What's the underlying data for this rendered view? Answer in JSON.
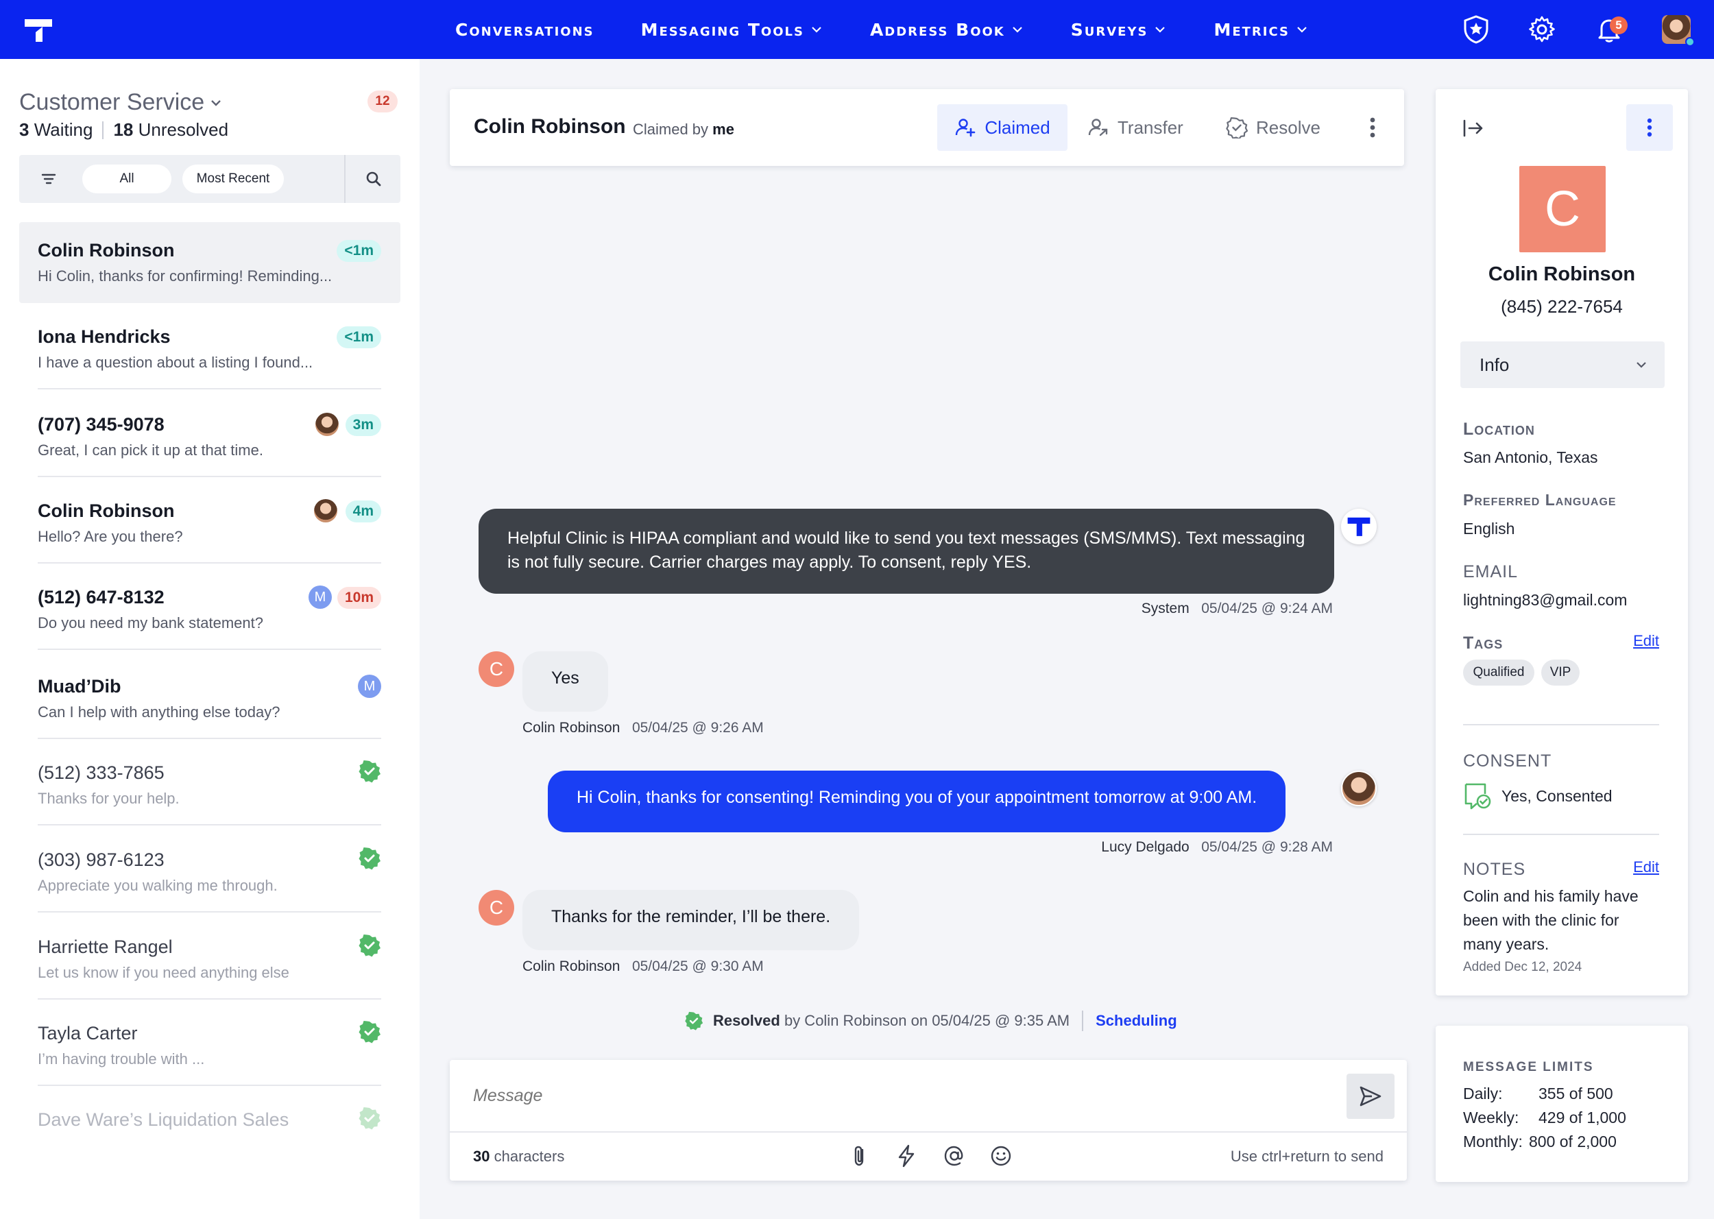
{
  "nav": {
    "items": [
      {
        "label": "Conversations",
        "has_menu": false
      },
      {
        "label": "Messaging Tools",
        "has_menu": true
      },
      {
        "label": "Address Book",
        "has_menu": true
      },
      {
        "label": "Surveys",
        "has_menu": true
      },
      {
        "label": "Metrics",
        "has_menu": true
      }
    ],
    "icons": [
      "shield-star-icon",
      "gear-icon",
      "bell-icon",
      "user-avatar"
    ],
    "notification_count": "5",
    "colors": {
      "bar": "#0a24ef",
      "accent": "#1d3df2"
    }
  },
  "inbox": {
    "title": "Customer Service",
    "badge": "12",
    "waiting_count": "3",
    "waiting_label": "Waiting",
    "unresolved_count": "18",
    "unresolved_label": "Unresolved",
    "filters": [
      "All",
      "Most Recent"
    ]
  },
  "conversations": [
    {
      "name": "Colin Robinson",
      "preview": "Hi Colin, thanks for confirming! Reminding...",
      "time": "<1m",
      "state": "active"
    },
    {
      "name": "Iona Hendricks",
      "preview": "I have a question about a listing I found...",
      "time": "<1m",
      "state": "unread"
    },
    {
      "name": "(707) 345-9078",
      "preview": "Great, I can pick it up at that time.",
      "time": "3m",
      "state": "unread",
      "assignee": "avatar"
    },
    {
      "name": "Colin Robinson",
      "preview": "Hello? Are you there?",
      "time": "4m",
      "state": "unread",
      "assignee": "avatar"
    },
    {
      "name": "(512) 647-8132",
      "preview": "Do you need my bank statement?",
      "time": "10m",
      "state": "unread",
      "assignee": "M"
    },
    {
      "name": "Muad’Dib",
      "preview": "Can I help with anything else today?",
      "time": "",
      "state": "unread",
      "assignee": "M"
    },
    {
      "name": "(512) 333-7865",
      "preview": "Thanks for your help.",
      "state": "resolved"
    },
    {
      "name": "(303) 987-6123",
      "preview": "Appreciate you walking me through.",
      "state": "resolved"
    },
    {
      "name": "Harriette Rangel",
      "preview": "Let us know if you need anything else",
      "state": "resolved"
    },
    {
      "name": "Tayla Carter",
      "preview": "I’m having trouble with ...",
      "state": "resolved"
    },
    {
      "name": "Dave Ware’s Liquidation Sales",
      "preview": "",
      "state": "resolved-faded"
    }
  ],
  "conversation_header": {
    "name": "Colin Robinson",
    "claimed_by_prefix": "Claimed by",
    "claimed_by": "me",
    "actions": {
      "claimed": "Claimed",
      "transfer": "Transfer",
      "resolve": "Resolve"
    }
  },
  "messages": [
    {
      "type": "system",
      "text": "Helpful Clinic is HIPAA compliant and would like to send you text messages (SMS/MMS). Text messaging is not fully secure. Carrier charges may apply. To consent, reply YES.",
      "sender": "System",
      "timestamp": "05/04/25 @ 9:24 AM"
    },
    {
      "type": "inbound",
      "text": "Yes",
      "sender": "Colin Robinson",
      "timestamp": "05/04/25 @ 9:26 AM",
      "avatar_letter": "C"
    },
    {
      "type": "outbound",
      "text": "Hi Colin, thanks for consenting! Reminding you of your appointment tomorrow at 9:00 AM.",
      "sender": "Lucy Delgado",
      "timestamp": "05/04/25 @ 9:28 AM"
    },
    {
      "type": "inbound",
      "text": "Thanks for the reminder, I’ll be there.",
      "sender": "Colin Robinson",
      "timestamp": "05/04/25 @ 9:30 AM",
      "avatar_letter": "C"
    }
  ],
  "resolution": {
    "label": "Resolved",
    "detail": "by Colin Robinson on 05/04/25 @ 9:35 AM",
    "tag_link": "Scheduling"
  },
  "composer": {
    "placeholder": "Message",
    "char_count": "30",
    "char_label": "characters",
    "hint": "Use ctrl+return to send",
    "tools": [
      "paperclip-icon",
      "lightning-icon",
      "at-sign-icon",
      "emoji-icon"
    ]
  },
  "contact": {
    "initial": "C",
    "name": "Colin Robinson",
    "phone": "(845) 222-7654",
    "section_select": "Info",
    "location_label": "Location",
    "location": "San Antonio, Texas",
    "language_label": "Preferred Language",
    "language": "English",
    "email_label": "EMAIL",
    "email": "lightning83@gmail.com",
    "tags_label": "Tags",
    "tags_edit": "Edit",
    "tags": [
      "Qualified",
      "VIP"
    ],
    "consent_label": "CONSENT",
    "consent_value": "Yes, Consented",
    "notes_label": "NOTES",
    "notes_edit": "Edit",
    "notes_line1": "Colin and his family have",
    "notes_line2": "been with the clinic for",
    "notes_line3": "many years.",
    "notes_added": "Added Dec 12, 2024",
    "avatar_color": "#f18a74"
  },
  "limits": {
    "title": "MESSAGE LIMITS",
    "daily_label": "Daily:",
    "daily": "355 of 500",
    "weekly_label": "Weekly:",
    "weekly": "429 of 1,000",
    "monthly_label": "Monthly:",
    "monthly": "800 of 2,000"
  }
}
